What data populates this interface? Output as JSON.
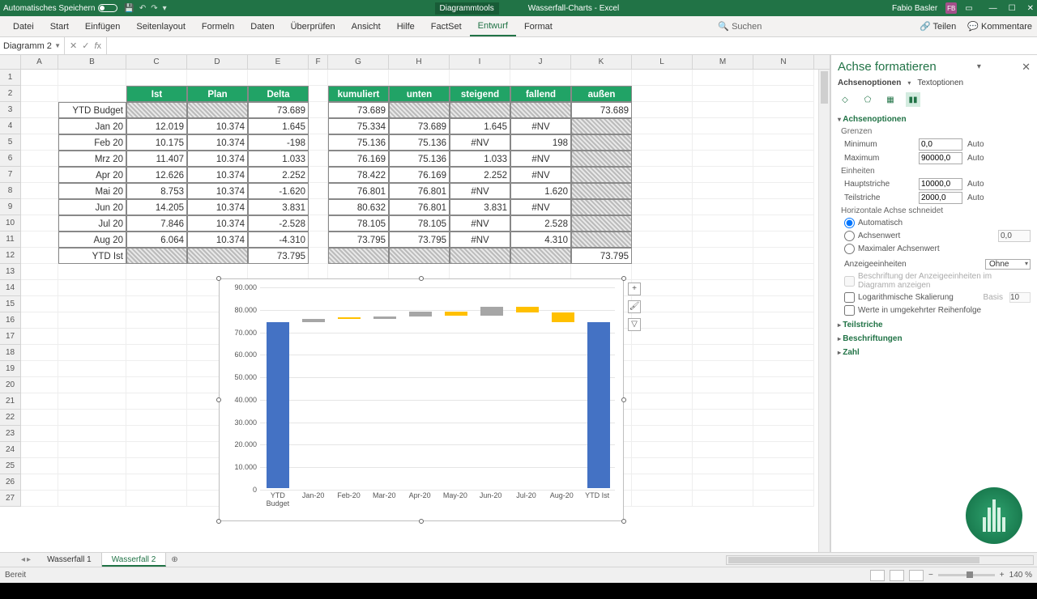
{
  "titlebar": {
    "autosave": "Automatisches Speichern",
    "tool": "Diagrammtools",
    "filename": "Wasserfall-Charts - Excel",
    "user": "Fabio Basler",
    "initials": "FB"
  },
  "menu": {
    "items": [
      "Datei",
      "Start",
      "Einfügen",
      "Seitenlayout",
      "Formeln",
      "Daten",
      "Überprüfen",
      "Ansicht",
      "Hilfe",
      "FactSet",
      "Entwurf",
      "Format"
    ],
    "active": "Entwurf",
    "search": "Suchen",
    "share": "Teilen",
    "comments": "Kommentare"
  },
  "namebox": "Diagramm 2",
  "columns": [
    "A",
    "B",
    "C",
    "D",
    "E",
    "F",
    "G",
    "H",
    "I",
    "J",
    "K",
    "L",
    "M",
    "N"
  ],
  "rownums": [
    "1",
    "2",
    "3",
    "4",
    "5",
    "6",
    "7",
    "8",
    "9",
    "10",
    "11",
    "12",
    "13",
    "14",
    "15",
    "16",
    "17",
    "18",
    "19",
    "20",
    "21",
    "22",
    "23",
    "24",
    "25",
    "26",
    "27"
  ],
  "table1": {
    "headers": [
      "Ist",
      "Plan",
      "Delta"
    ],
    "rowlabels": [
      "YTD Budget",
      "Jan 20",
      "Feb 20",
      "Mrz 20",
      "Apr 20",
      "Mai 20",
      "Jun 20",
      "Jul 20",
      "Aug 20",
      "YTD Ist"
    ],
    "data": [
      [
        "",
        "",
        "73.689"
      ],
      [
        "12.019",
        "10.374",
        "1.645"
      ],
      [
        "10.175",
        "10.374",
        "-198"
      ],
      [
        "11.407",
        "10.374",
        "1.033"
      ],
      [
        "12.626",
        "10.374",
        "2.252"
      ],
      [
        "8.753",
        "10.374",
        "-1.620"
      ],
      [
        "14.205",
        "10.374",
        "3.831"
      ],
      [
        "7.846",
        "10.374",
        "-2.528"
      ],
      [
        "6.064",
        "10.374",
        "-4.310"
      ],
      [
        "",
        "",
        "73.795"
      ]
    ],
    "hatch_cells": [
      [
        0,
        0
      ],
      [
        0,
        1
      ],
      [
        9,
        0
      ],
      [
        9,
        1
      ]
    ]
  },
  "table2": {
    "headers": [
      "kumuliert",
      "unten",
      "steigend",
      "fallend",
      "außen"
    ],
    "data": [
      [
        "73.689",
        "",
        "",
        "",
        "73.689"
      ],
      [
        "75.334",
        "73.689",
        "1.645",
        "#NV",
        ""
      ],
      [
        "75.136",
        "75.136",
        "#NV",
        "198",
        ""
      ],
      [
        "76.169",
        "75.136",
        "1.033",
        "#NV",
        ""
      ],
      [
        "78.422",
        "76.169",
        "2.252",
        "#NV",
        ""
      ],
      [
        "76.801",
        "76.801",
        "#NV",
        "1.620",
        ""
      ],
      [
        "80.632",
        "76.801",
        "3.831",
        "#NV",
        ""
      ],
      [
        "78.105",
        "78.105",
        "#NV",
        "2.528",
        ""
      ],
      [
        "73.795",
        "73.795",
        "#NV",
        "4.310",
        ""
      ],
      [
        "",
        "",
        "",
        "",
        "73.795"
      ]
    ],
    "hatch_cells": [
      [
        0,
        1
      ],
      [
        0,
        2
      ],
      [
        0,
        3
      ],
      [
        1,
        4
      ],
      [
        2,
        4
      ],
      [
        3,
        4
      ],
      [
        4,
        4
      ],
      [
        5,
        4
      ],
      [
        6,
        4
      ],
      [
        7,
        4
      ],
      [
        8,
        4
      ],
      [
        9,
        0
      ],
      [
        9,
        1
      ],
      [
        9,
        2
      ],
      [
        9,
        3
      ]
    ]
  },
  "chart_data": {
    "type": "bar",
    "title": "",
    "categories": [
      "YTD Budget",
      "Jan-20",
      "Feb-20",
      "Mar-20",
      "Apr-20",
      "May-20",
      "Jun-20",
      "Jul-20",
      "Aug-20",
      "YTD Ist"
    ],
    "ylim": [
      0,
      90000
    ],
    "ytick_step": 10000,
    "ytick_labels": [
      "0",
      "10.000",
      "20.000",
      "30.000",
      "40.000",
      "50.000",
      "60.000",
      "70.000",
      "80.000",
      "90.000"
    ],
    "series": [
      {
        "name": "außen",
        "type": "full",
        "color": "#4472c4",
        "values": [
          73689,
          null,
          null,
          null,
          null,
          null,
          null,
          null,
          null,
          73795
        ]
      },
      {
        "name": "unten",
        "type": "invisible",
        "values": [
          null,
          73689,
          75136,
          75136,
          76169,
          76801,
          76801,
          78105,
          73795,
          null
        ]
      },
      {
        "name": "steigend",
        "type": "float",
        "color": "#a6a6a6",
        "values": [
          null,
          1645,
          null,
          1033,
          2252,
          null,
          3831,
          null,
          null,
          null
        ]
      },
      {
        "name": "fallend",
        "type": "float",
        "color": "#ffc000",
        "values": [
          null,
          null,
          198,
          null,
          null,
          1620,
          null,
          2528,
          4310,
          null
        ]
      }
    ]
  },
  "sidepane": {
    "title": "Achse formatieren",
    "tab1": "Achsenoptionen",
    "tab2": "Textoptionen",
    "sec_axis": "Achsenoptionen",
    "grp_bounds": "Grenzen",
    "lbl_min": "Minimum",
    "val_min": "0,0",
    "auto": "Auto",
    "lbl_max": "Maximum",
    "val_max": "90000,0",
    "grp_units": "Einheiten",
    "lbl_major": "Hauptstriche",
    "val_major": "10000,0",
    "lbl_minor": "Teilstriche",
    "val_minor": "2000,0",
    "grp_cross": "Horizontale Achse schneidet",
    "r1": "Automatisch",
    "r2": "Achsenwert",
    "r2v": "0,0",
    "r3": "Maximaler Achsenwert",
    "lbl_dispunits": "Anzeigeeinheiten",
    "val_dispunits": "Ohne",
    "chk_dispunit_label": "Beschriftung der Anzeigeeinheiten im Diagramm anzeigen",
    "chk_log": "Logarithmische Skalierung",
    "log_basis_l": "Basis",
    "log_basis": "10",
    "chk_rev": "Werte in umgekehrter Reihenfolge",
    "sec_ticks": "Teilstriche",
    "sec_labels": "Beschriftungen",
    "sec_number": "Zahl"
  },
  "sheets": {
    "tabs": [
      "Wasserfall 1",
      "Wasserfall 2"
    ],
    "active": 1
  },
  "status": {
    "ready": "Bereit",
    "zoom": "140 %"
  }
}
